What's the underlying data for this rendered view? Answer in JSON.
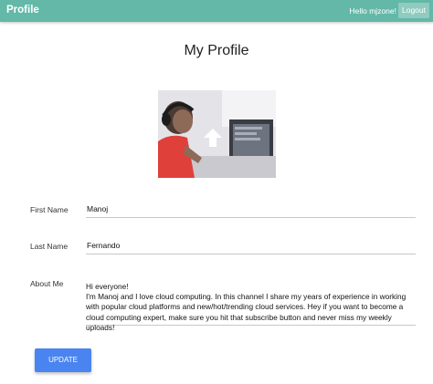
{
  "navbar": {
    "brand": "Profile",
    "greeting": "Hello mjzone!",
    "logout_label": "Logout",
    "bg_color": "#63b8a8"
  },
  "page": {
    "title": "My Profile"
  },
  "profile_photo": {
    "icon": "profile-photo"
  },
  "form": {
    "first_name": {
      "label": "First Name",
      "value": "Manoj"
    },
    "last_name": {
      "label": "Last Name",
      "value": "Fernando"
    },
    "about_me": {
      "label": "About Me",
      "value": "Hi everyone!\nI'm Manoj and I love cloud computing. In this channel I share my years of experience in working with popular cloud platforms and new/hot/trending cloud services. Hey if you want to become a cloud computing expert, make sure you hit that subscribe button and never miss my weekly uploads!"
    },
    "update_label": "UPDATE",
    "update_color": "#4a84f0"
  }
}
